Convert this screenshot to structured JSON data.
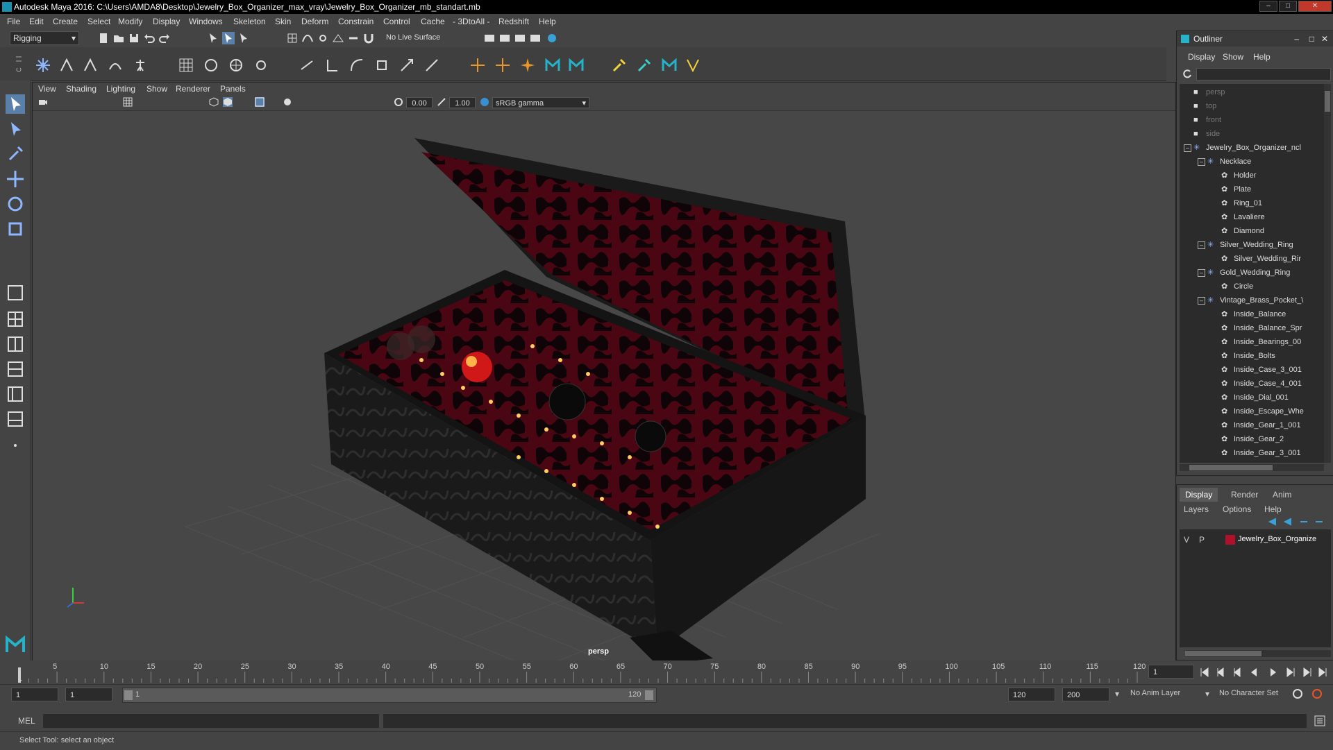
{
  "window": {
    "title": "Autodesk Maya 2016: C:\\Users\\AMDA8\\Desktop\\Jewelry_Box_Organizer_max_vray\\Jewelry_Box_Organizer_mb_standart.mb"
  },
  "menubar": [
    "File",
    "Edit",
    "Create",
    "Select",
    "Modify",
    "Display",
    "Windows",
    "Skeleton",
    "Skin",
    "Deform",
    "Constrain",
    "Control",
    "Cache",
    "- 3DtoAll -",
    "Redshift",
    "Help"
  ],
  "shelf": {
    "mode": "Rigging",
    "live_surface": "No Live Surface"
  },
  "viewport": {
    "menu": [
      "View",
      "Shading",
      "Lighting",
      "Show",
      "Renderer",
      "Panels"
    ],
    "field1": "0.00",
    "field2": "1.00",
    "colorspace": "sRGB gamma",
    "camera": "persp"
  },
  "outliner": {
    "title": "Outliner",
    "menu": [
      "Display",
      "Show",
      "Help"
    ],
    "items": [
      {
        "label": "persp",
        "depth": 1,
        "dim": true,
        "icon": "camera-icon"
      },
      {
        "label": "top",
        "depth": 1,
        "dim": true,
        "icon": "camera-icon"
      },
      {
        "label": "front",
        "depth": 1,
        "dim": true,
        "icon": "camera-icon"
      },
      {
        "label": "side",
        "depth": 1,
        "dim": true,
        "icon": "camera-icon"
      },
      {
        "label": "Jewelry_Box_Organizer_ncl",
        "depth": 1,
        "icon": "group-icon",
        "expand": true
      },
      {
        "label": "Necklace",
        "depth": 2,
        "icon": "group-icon",
        "expand": true
      },
      {
        "label": "Holder",
        "depth": 3,
        "icon": "mesh-icon"
      },
      {
        "label": "Plate",
        "depth": 3,
        "icon": "mesh-icon"
      },
      {
        "label": "Ring_01",
        "depth": 3,
        "icon": "mesh-icon"
      },
      {
        "label": "Lavaliere",
        "depth": 3,
        "icon": "mesh-icon"
      },
      {
        "label": "Diamond",
        "depth": 3,
        "icon": "mesh-icon"
      },
      {
        "label": "Silver_Wedding_Ring",
        "depth": 2,
        "icon": "group-icon",
        "expand": true
      },
      {
        "label": "Silver_Wedding_Rir",
        "depth": 3,
        "icon": "mesh-icon"
      },
      {
        "label": "Gold_Wedding_Ring",
        "depth": 2,
        "icon": "group-icon",
        "expand": true
      },
      {
        "label": "Circle",
        "depth": 3,
        "icon": "mesh-icon"
      },
      {
        "label": "Vintage_Brass_Pocket_\\",
        "depth": 2,
        "icon": "group-icon",
        "expand": true
      },
      {
        "label": "Inside_Balance",
        "depth": 3,
        "icon": "mesh-icon"
      },
      {
        "label": "Inside_Balance_Spr",
        "depth": 3,
        "icon": "mesh-icon"
      },
      {
        "label": "Inside_Bearings_00",
        "depth": 3,
        "icon": "mesh-icon"
      },
      {
        "label": "Inside_Bolts",
        "depth": 3,
        "icon": "mesh-icon"
      },
      {
        "label": "Inside_Case_3_001",
        "depth": 3,
        "icon": "mesh-icon"
      },
      {
        "label": "Inside_Case_4_001",
        "depth": 3,
        "icon": "mesh-icon"
      },
      {
        "label": "Inside_Dial_001",
        "depth": 3,
        "icon": "mesh-icon"
      },
      {
        "label": "Inside_Escape_Whe",
        "depth": 3,
        "icon": "mesh-icon"
      },
      {
        "label": "Inside_Gear_1_001",
        "depth": 3,
        "icon": "mesh-icon"
      },
      {
        "label": "Inside_Gear_2",
        "depth": 3,
        "icon": "mesh-icon"
      },
      {
        "label": "Inside_Gear_3_001",
        "depth": 3,
        "icon": "mesh-icon"
      }
    ]
  },
  "layers": {
    "tabs": [
      "Display",
      "Render",
      "Anim"
    ],
    "menu": [
      "Layers",
      "Options",
      "Help"
    ],
    "row": {
      "v": "V",
      "p": "P",
      "name": "Jewelry_Box_Organize",
      "color": "#b0102a"
    }
  },
  "timeline": {
    "ticks": [
      "5",
      "10",
      "15",
      "20",
      "25",
      "30",
      "35",
      "40",
      "45",
      "50",
      "55",
      "60",
      "65",
      "70",
      "75",
      "80",
      "85",
      "90",
      "95",
      "100",
      "105",
      "110",
      "115",
      "120"
    ],
    "start_label": "1",
    "current_frame": "1"
  },
  "range": {
    "start": "1",
    "start2": "1",
    "slider_start": "1",
    "slider_end": "120",
    "end": "120",
    "end2": "200",
    "anim_layer": "No Anim Layer",
    "char_set": "No Character Set"
  },
  "mel": {
    "label": "MEL"
  },
  "help": {
    "text": "Select Tool: select an object"
  }
}
